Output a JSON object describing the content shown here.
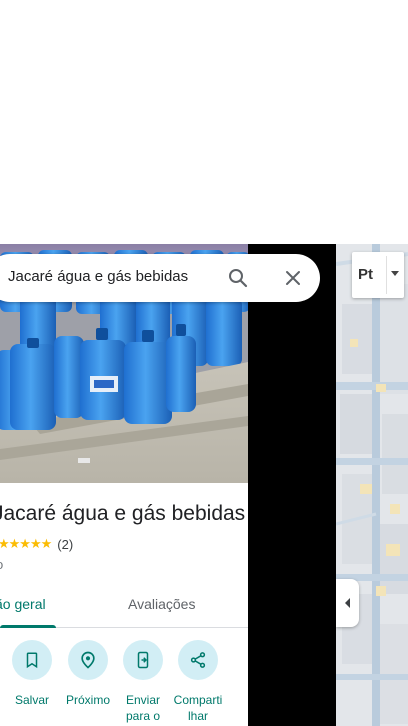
{
  "search": {
    "value": "Jacaré água e gás bebidas",
    "placeholder": ""
  },
  "place": {
    "title": "Jacaré água e gás bebidas",
    "rating_stars": "★★★★★",
    "rating_count": "(2)",
    "category": "o"
  },
  "tabs": [
    {
      "label": "ão geral",
      "active": true
    },
    {
      "label": "Avaliações",
      "active": false
    }
  ],
  "actions": [
    {
      "label": "Salvar",
      "icon": "bookmark-icon"
    },
    {
      "label": "Próximo",
      "icon": "nearby-icon"
    },
    {
      "label": "Enviar para o",
      "icon": "send-to-phone-icon"
    },
    {
      "label": "Comparti lhar",
      "icon": "share-icon"
    }
  ],
  "layer_control": {
    "label": "Pt"
  },
  "colors": {
    "accent": "#00796b",
    "action_bg": "#d2eef5",
    "star": "#fbbc04"
  }
}
